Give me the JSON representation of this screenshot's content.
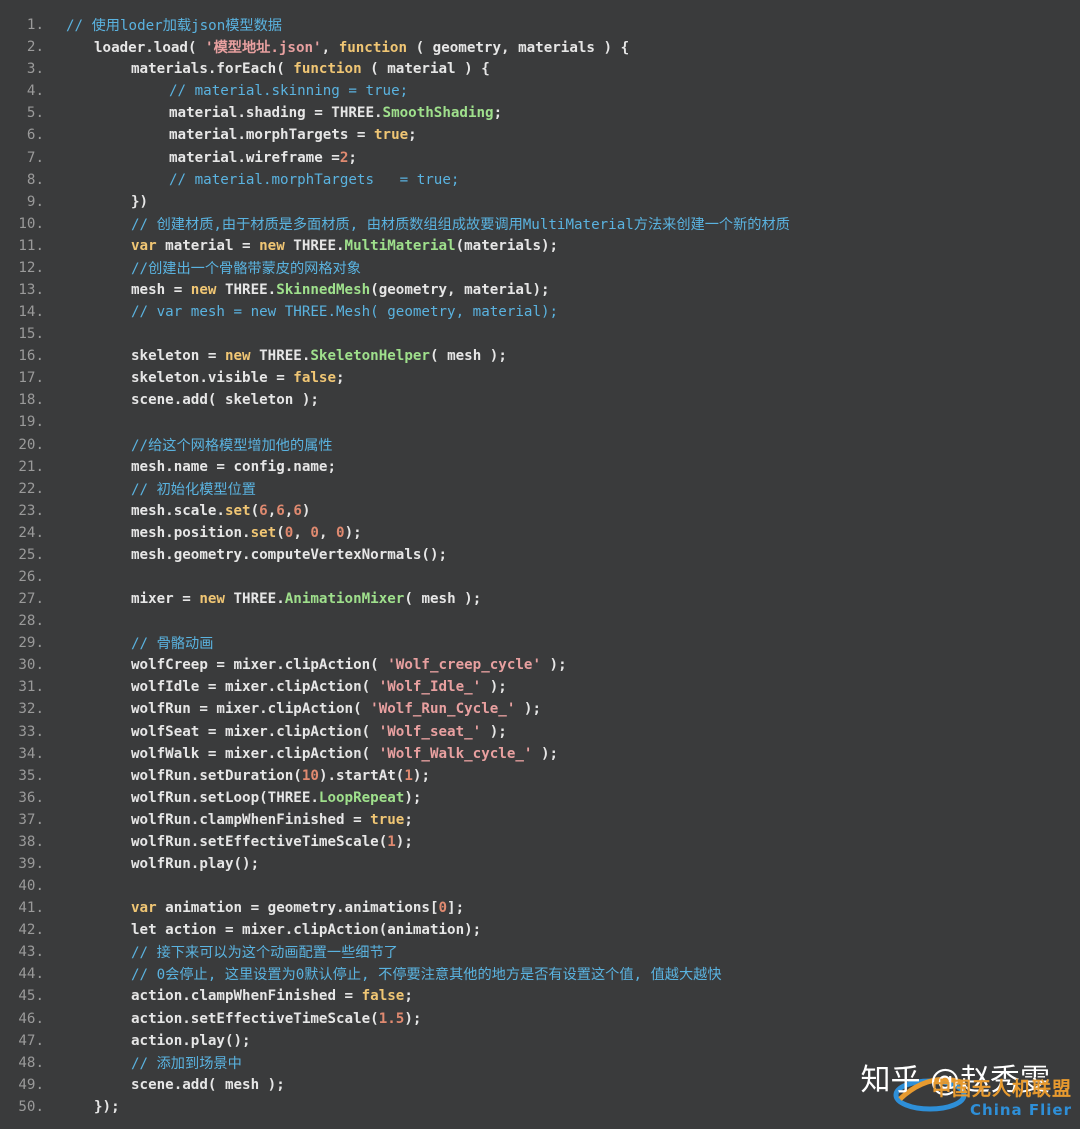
{
  "lines": [
    {
      "n": "1.",
      "indent": 0,
      "tokens": [
        {
          "t": "cm",
          "v": "// 使用loder加载json模型数据"
        }
      ]
    },
    {
      "n": "2.",
      "indent": 1,
      "tokens": [
        {
          "t": "p",
          "v": "loader.load( "
        },
        {
          "t": "str",
          "v": "'模型地址.json'"
        },
        {
          "t": "p",
          "v": ", "
        },
        {
          "t": "kw",
          "v": "function"
        },
        {
          "t": "p",
          "v": " ( geometry, materials ) {"
        }
      ]
    },
    {
      "n": "3.",
      "indent": 2,
      "tokens": [
        {
          "t": "p",
          "v": "materials.forEach( "
        },
        {
          "t": "kw",
          "v": "function"
        },
        {
          "t": "p",
          "v": " ( material ) {"
        }
      ]
    },
    {
      "n": "4.",
      "indent": 3,
      "tokens": [
        {
          "t": "cm",
          "v": "// material.skinning = true;"
        }
      ]
    },
    {
      "n": "5.",
      "indent": 3,
      "tokens": [
        {
          "t": "p",
          "v": "material.shading = THREE."
        },
        {
          "t": "cl",
          "v": "SmoothShading"
        },
        {
          "t": "p",
          "v": ";"
        }
      ]
    },
    {
      "n": "6.",
      "indent": 3,
      "tokens": [
        {
          "t": "p",
          "v": "material.morphTargets = "
        },
        {
          "t": "kw",
          "v": "true"
        },
        {
          "t": "p",
          "v": ";"
        }
      ]
    },
    {
      "n": "7.",
      "indent": 3,
      "tokens": [
        {
          "t": "p",
          "v": "material.wireframe ="
        },
        {
          "t": "num",
          "v": "2"
        },
        {
          "t": "p",
          "v": ";"
        }
      ]
    },
    {
      "n": "8.",
      "indent": 3,
      "tokens": [
        {
          "t": "cm",
          "v": "// material.morphTargets   = true;"
        }
      ]
    },
    {
      "n": "9.",
      "indent": 2,
      "tokens": [
        {
          "t": "p",
          "v": "})"
        }
      ]
    },
    {
      "n": "10.",
      "indent": 2,
      "tokens": [
        {
          "t": "cm",
          "v": "// 创建材质,由于材质是多面材质, 由材质数组组成故要调用MultiMaterial方法来创建一个新的材质"
        }
      ]
    },
    {
      "n": "11.",
      "indent": 2,
      "tokens": [
        {
          "t": "kw",
          "v": "var"
        },
        {
          "t": "p",
          "v": " material = "
        },
        {
          "t": "kw",
          "v": "new"
        },
        {
          "t": "p",
          "v": " THREE."
        },
        {
          "t": "cl",
          "v": "MultiMaterial"
        },
        {
          "t": "p",
          "v": "(materials);"
        }
      ]
    },
    {
      "n": "12.",
      "indent": 2,
      "tokens": [
        {
          "t": "cm",
          "v": "//创建出一个骨骼带蒙皮的网格对象"
        }
      ]
    },
    {
      "n": "13.",
      "indent": 2,
      "tokens": [
        {
          "t": "p",
          "v": "mesh = "
        },
        {
          "t": "kw",
          "v": "new"
        },
        {
          "t": "p",
          "v": " THREE."
        },
        {
          "t": "cl",
          "v": "SkinnedMesh"
        },
        {
          "t": "p",
          "v": "(geometry, material);"
        }
      ]
    },
    {
      "n": "14.",
      "indent": 2,
      "tokens": [
        {
          "t": "cm",
          "v": "// var mesh = new THREE.Mesh( geometry, material);"
        }
      ]
    },
    {
      "n": "15.",
      "indent": 0,
      "tokens": []
    },
    {
      "n": "16.",
      "indent": 2,
      "tokens": [
        {
          "t": "p",
          "v": "skeleton = "
        },
        {
          "t": "kw",
          "v": "new"
        },
        {
          "t": "p",
          "v": " THREE."
        },
        {
          "t": "cl",
          "v": "SkeletonHelper"
        },
        {
          "t": "p",
          "v": "( mesh );"
        }
      ]
    },
    {
      "n": "17.",
      "indent": 2,
      "tokens": [
        {
          "t": "p",
          "v": "skeleton.visible = "
        },
        {
          "t": "kw",
          "v": "false"
        },
        {
          "t": "p",
          "v": ";"
        }
      ]
    },
    {
      "n": "18.",
      "indent": 2,
      "tokens": [
        {
          "t": "p",
          "v": "scene.add( skeleton );"
        }
      ]
    },
    {
      "n": "19.",
      "indent": 0,
      "tokens": []
    },
    {
      "n": "20.",
      "indent": 2,
      "tokens": [
        {
          "t": "cm",
          "v": "//给这个网格模型增加他的属性"
        }
      ]
    },
    {
      "n": "21.",
      "indent": 2,
      "tokens": [
        {
          "t": "p",
          "v": "mesh.name = config.name;"
        }
      ]
    },
    {
      "n": "22.",
      "indent": 2,
      "tokens": [
        {
          "t": "cm",
          "v": "// 初始化模型位置"
        }
      ]
    },
    {
      "n": "23.",
      "indent": 2,
      "tokens": [
        {
          "t": "p",
          "v": "mesh.scale."
        },
        {
          "t": "kw",
          "v": "set"
        },
        {
          "t": "p",
          "v": "("
        },
        {
          "t": "num",
          "v": "6"
        },
        {
          "t": "p",
          "v": ","
        },
        {
          "t": "num",
          "v": "6"
        },
        {
          "t": "p",
          "v": ","
        },
        {
          "t": "num",
          "v": "6"
        },
        {
          "t": "p",
          "v": ")"
        }
      ]
    },
    {
      "n": "24.",
      "indent": 2,
      "tokens": [
        {
          "t": "p",
          "v": "mesh.position."
        },
        {
          "t": "kw",
          "v": "set"
        },
        {
          "t": "p",
          "v": "("
        },
        {
          "t": "num",
          "v": "0"
        },
        {
          "t": "p",
          "v": ", "
        },
        {
          "t": "num",
          "v": "0"
        },
        {
          "t": "p",
          "v": ", "
        },
        {
          "t": "num",
          "v": "0"
        },
        {
          "t": "p",
          "v": ");"
        }
      ]
    },
    {
      "n": "25.",
      "indent": 2,
      "tokens": [
        {
          "t": "p",
          "v": "mesh.geometry.computeVertexNormals();"
        }
      ]
    },
    {
      "n": "26.",
      "indent": 0,
      "tokens": []
    },
    {
      "n": "27.",
      "indent": 2,
      "tokens": [
        {
          "t": "p",
          "v": "mixer = "
        },
        {
          "t": "kw",
          "v": "new"
        },
        {
          "t": "p",
          "v": " THREE."
        },
        {
          "t": "cl",
          "v": "AnimationMixer"
        },
        {
          "t": "p",
          "v": "( mesh );"
        }
      ]
    },
    {
      "n": "28.",
      "indent": 0,
      "tokens": []
    },
    {
      "n": "29.",
      "indent": 2,
      "tokens": [
        {
          "t": "cm",
          "v": "// 骨骼动画"
        }
      ]
    },
    {
      "n": "30.",
      "indent": 2,
      "tokens": [
        {
          "t": "p",
          "v": "wolfCreep = mixer.clipAction( "
        },
        {
          "t": "str",
          "v": "'Wolf_creep_cycle'"
        },
        {
          "t": "p",
          "v": " );"
        }
      ]
    },
    {
      "n": "31.",
      "indent": 2,
      "tokens": [
        {
          "t": "p",
          "v": "wolfIdle = mixer.clipAction( "
        },
        {
          "t": "str",
          "v": "'Wolf_Idle_'"
        },
        {
          "t": "p",
          "v": " );"
        }
      ]
    },
    {
      "n": "32.",
      "indent": 2,
      "tokens": [
        {
          "t": "p",
          "v": "wolfRun = mixer.clipAction( "
        },
        {
          "t": "str",
          "v": "'Wolf_Run_Cycle_'"
        },
        {
          "t": "p",
          "v": " );"
        }
      ]
    },
    {
      "n": "33.",
      "indent": 2,
      "tokens": [
        {
          "t": "p",
          "v": "wolfSeat = mixer.clipAction( "
        },
        {
          "t": "str",
          "v": "'Wolf_seat_'"
        },
        {
          "t": "p",
          "v": " );"
        }
      ]
    },
    {
      "n": "34.",
      "indent": 2,
      "tokens": [
        {
          "t": "p",
          "v": "wolfWalk = mixer.clipAction( "
        },
        {
          "t": "str",
          "v": "'Wolf_Walk_cycle_'"
        },
        {
          "t": "p",
          "v": " );"
        }
      ]
    },
    {
      "n": "35.",
      "indent": 2,
      "tokens": [
        {
          "t": "p",
          "v": "wolfRun.setDuration("
        },
        {
          "t": "num",
          "v": "10"
        },
        {
          "t": "p",
          "v": ").startAt("
        },
        {
          "t": "num",
          "v": "1"
        },
        {
          "t": "p",
          "v": ");"
        }
      ]
    },
    {
      "n": "36.",
      "indent": 2,
      "tokens": [
        {
          "t": "p",
          "v": "wolfRun.setLoop(THREE."
        },
        {
          "t": "cl",
          "v": "LoopRepeat"
        },
        {
          "t": "p",
          "v": ");"
        }
      ]
    },
    {
      "n": "37.",
      "indent": 2,
      "tokens": [
        {
          "t": "p",
          "v": "wolfRun.clampWhenFinished = "
        },
        {
          "t": "kw",
          "v": "true"
        },
        {
          "t": "p",
          "v": ";"
        }
      ]
    },
    {
      "n": "38.",
      "indent": 2,
      "tokens": [
        {
          "t": "p",
          "v": "wolfRun.setEffectiveTimeScale("
        },
        {
          "t": "num",
          "v": "1"
        },
        {
          "t": "p",
          "v": ");"
        }
      ]
    },
    {
      "n": "39.",
      "indent": 2,
      "tokens": [
        {
          "t": "p",
          "v": "wolfRun.play();"
        }
      ]
    },
    {
      "n": "40.",
      "indent": 0,
      "tokens": []
    },
    {
      "n": "41.",
      "indent": 2,
      "tokens": [
        {
          "t": "kw",
          "v": "var"
        },
        {
          "t": "p",
          "v": " animation = geometry.animations["
        },
        {
          "t": "num",
          "v": "0"
        },
        {
          "t": "p",
          "v": "];"
        }
      ]
    },
    {
      "n": "42.",
      "indent": 2,
      "tokens": [
        {
          "t": "p",
          "v": "let action = mixer.clipAction(animation);"
        }
      ]
    },
    {
      "n": "43.",
      "indent": 2,
      "tokens": [
        {
          "t": "cm",
          "v": "// 接下来可以为这个动画配置一些细节了"
        }
      ]
    },
    {
      "n": "44.",
      "indent": 2,
      "tokens": [
        {
          "t": "cm",
          "v": "// 0会停止, 这里设置为0默认停止, 不停要注意其他的地方是否有设置这个值, 值越大越快"
        }
      ]
    },
    {
      "n": "45.",
      "indent": 2,
      "tokens": [
        {
          "t": "p",
          "v": "action.clampWhenFinished = "
        },
        {
          "t": "kw",
          "v": "false"
        },
        {
          "t": "p",
          "v": ";"
        }
      ]
    },
    {
      "n": "46.",
      "indent": 2,
      "tokens": [
        {
          "t": "p",
          "v": "action.setEffectiveTimeScale("
        },
        {
          "t": "num",
          "v": "1.5"
        },
        {
          "t": "p",
          "v": ");"
        }
      ]
    },
    {
      "n": "47.",
      "indent": 2,
      "tokens": [
        {
          "t": "p",
          "v": "action.play();"
        }
      ]
    },
    {
      "n": "48.",
      "indent": 2,
      "tokens": [
        {
          "t": "cm",
          "v": "// 添加到场景中"
        }
      ]
    },
    {
      "n": "49.",
      "indent": 2,
      "tokens": [
        {
          "t": "p",
          "v": "scene.add( mesh );"
        }
      ]
    },
    {
      "n": "50.",
      "indent": 1,
      "tokens": [
        {
          "t": "p",
          "v": "});"
        }
      ]
    }
  ],
  "watermark": {
    "author": "知乎 @赵秀雯",
    "brand_cn": "中国无人机联盟",
    "brand_en": "China Flier"
  },
  "colors": {
    "background": "#3a3b3c",
    "keyword": "#f0c674",
    "class": "#9fe08c",
    "string": "#e8a0a0",
    "number": "#e08a70",
    "comment": "#5ab3e0",
    "plain": "#e6e6e6",
    "line_number": "#9a9a9a"
  }
}
